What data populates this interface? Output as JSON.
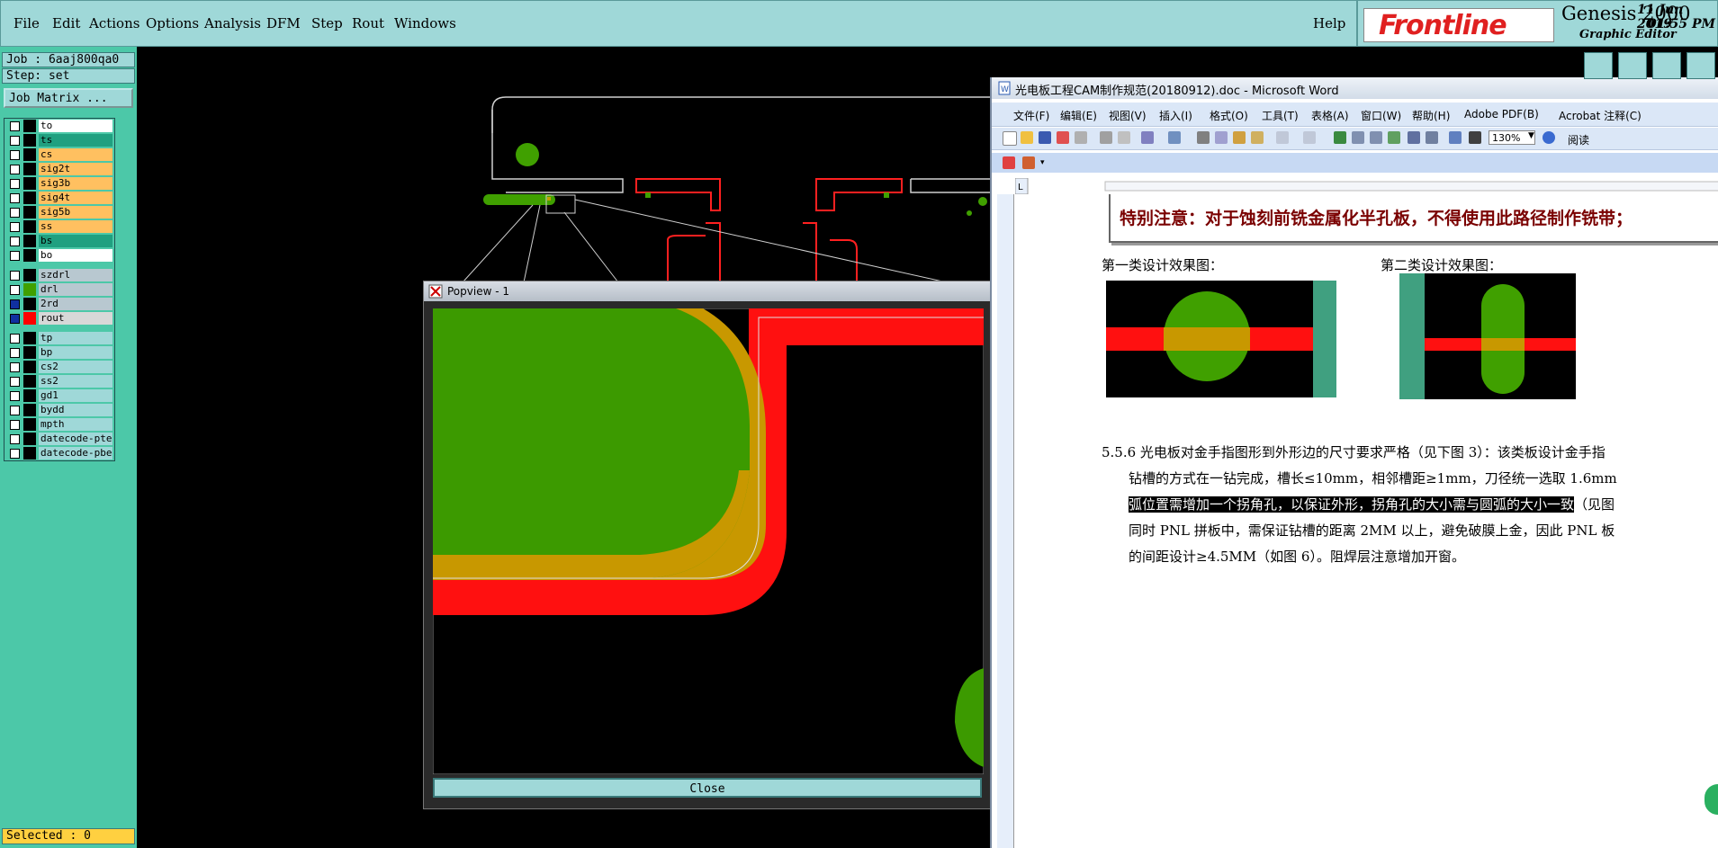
{
  "menubar": {
    "items": [
      "File",
      "Edit",
      "Actions",
      "Options",
      "Analysis",
      "DFM",
      "Step",
      "Rout",
      "Windows"
    ],
    "help": "Help"
  },
  "brand": {
    "logo_text": "Frontline",
    "product": "Genesis 2000",
    "subtitle": "Graphic Editor",
    "date": "11 Jun 2019",
    "time": "01:55 PM"
  },
  "job_panel": {
    "job": "Job : 6aaj800qa0",
    "step": "Step: set",
    "job_matrix_button": "Job Matrix ...",
    "selected": "Selected : 0"
  },
  "layers": [
    {
      "name": "to",
      "color": "#ffffff",
      "swatch": "#000000"
    },
    {
      "name": "ts",
      "color": "#20a080",
      "swatch": "#000000"
    },
    {
      "name": "cs",
      "color": "#ffc060",
      "swatch": "#000000"
    },
    {
      "name": "sig2t",
      "color": "#ffc060",
      "swatch": "#000000"
    },
    {
      "name": "sig3b",
      "color": "#ffc060",
      "swatch": "#000000"
    },
    {
      "name": "sig4t",
      "color": "#ffc060",
      "swatch": "#000000"
    },
    {
      "name": "sig5b",
      "color": "#ffc060",
      "swatch": "#000000"
    },
    {
      "name": "ss",
      "color": "#ffc060",
      "swatch": "#000000"
    },
    {
      "name": "bs",
      "color": "#20a080",
      "swatch": "#000000"
    },
    {
      "name": "bo",
      "color": "#ffffff",
      "swatch": "#000000"
    },
    {
      "name": "szdrl",
      "color": "#b8c8d0",
      "swatch": "#000000",
      "sep_before": true
    },
    {
      "name": "drl",
      "color": "#b8c8d0",
      "swatch": "#40a000"
    },
    {
      "name": "2rd",
      "color": "#b8c8d0",
      "swatch": "#000000",
      "checked": true
    },
    {
      "name": "rout",
      "color": "#d8d8d8",
      "swatch": "#ff0000",
      "checked": true
    },
    {
      "name": "tp",
      "color": "#9fd8d8",
      "swatch": "#000000",
      "sep_before": true
    },
    {
      "name": "bp",
      "color": "#9fd8d8",
      "swatch": "#000000"
    },
    {
      "name": "cs2",
      "color": "#9fd8d8",
      "swatch": "#000000"
    },
    {
      "name": "ss2",
      "color": "#9fd8d8",
      "swatch": "#000000"
    },
    {
      "name": "gd1",
      "color": "#9fd8d8",
      "swatch": "#000000"
    },
    {
      "name": "bydd",
      "color": "#9fd8d8",
      "swatch": "#000000"
    },
    {
      "name": "mpth",
      "color": "#9fd8d8",
      "swatch": "#000000"
    },
    {
      "name": "datecode-pte",
      "color": "#9fd8d8",
      "swatch": "#000000"
    },
    {
      "name": "datecode-pbe",
      "color": "#9fd8d8",
      "swatch": "#000000"
    }
  ],
  "popview": {
    "title": "Popview - 1",
    "close_label": "Close"
  },
  "word": {
    "title": "光电板工程CAM制作规范(20180912).doc - Microsoft Word",
    "menu": [
      "文件(F)",
      "编辑(E)",
      "视图(V)",
      "插入(I)",
      "格式(O)",
      "工具(T)",
      "表格(A)",
      "窗口(W)",
      "帮助(H)",
      "Adobe PDF(B)",
      "Acrobat 注释(C)"
    ],
    "zoom": "130%",
    "reading": "阅读",
    "notice": "特别注意：对于蚀刻前铣金属化半孔板，不得使用此路径制作铣带；",
    "caption1": "第一类设计效果图：",
    "caption2": "第二类设计效果图：",
    "para_line1": "5.5.6  光电板对金手指图形到外形边的尺寸要求严格（见下图 3）：该类板设计金手指",
    "para_line2": "钻槽的方式在一钻完成，槽长≤10mm，相邻槽距≥1mm，刀径统一选取 1.6mm",
    "para_line3_hl": "弧位置需增加一个拐角孔，以保证外形，拐角孔的大小需与圆弧的大小一致",
    "para_line3_rest": "（见图",
    "para_line4": "同时 PNL 拼板中，需保证钻槽的距离 2MM 以上，避免破膜上金，因此 PNL 板",
    "para_line5": "的间距设计≥4.5MM（如图 6）。阻焊层注意增加开窗。"
  }
}
